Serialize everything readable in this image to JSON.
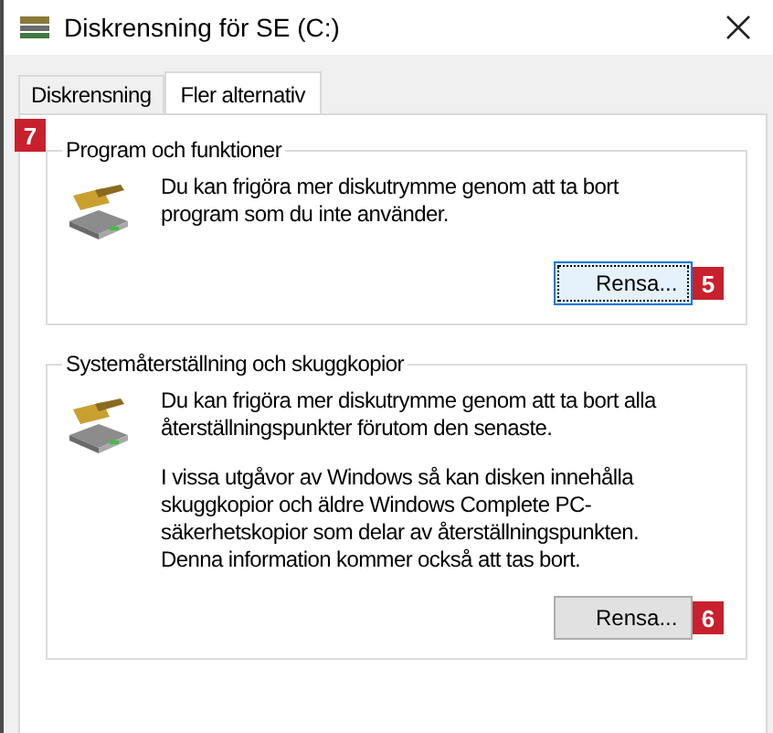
{
  "window": {
    "title": "Diskrensning för SE (C:)"
  },
  "tabs": [
    {
      "label": "Diskrensning",
      "selected": false
    },
    {
      "label": "Fler alternativ",
      "selected": true
    }
  ],
  "panel_badge": "7",
  "groups": [
    {
      "title": "Program och funktioner",
      "paragraphs": [
        "Du kan frigöra mer diskutrymme genom att ta bort program som du inte använder."
      ],
      "button": {
        "label": "Rensa...",
        "focused": true
      },
      "badge": "5"
    },
    {
      "title": "Systemåterställning och skuggkopior",
      "paragraphs": [
        "Du kan frigöra mer diskutrymme genom att ta bort alla återställningspunkter förutom den senaste.",
        "I vissa utgåvor av Windows så kan disken innehålla skuggkopior och äldre Windows Complete PC-säkerhetskopior som delar av återställningspunkten. Denna information kommer också att tas bort."
      ],
      "button": {
        "label": "Rensa...",
        "focused": false
      },
      "badge": "6"
    }
  ]
}
